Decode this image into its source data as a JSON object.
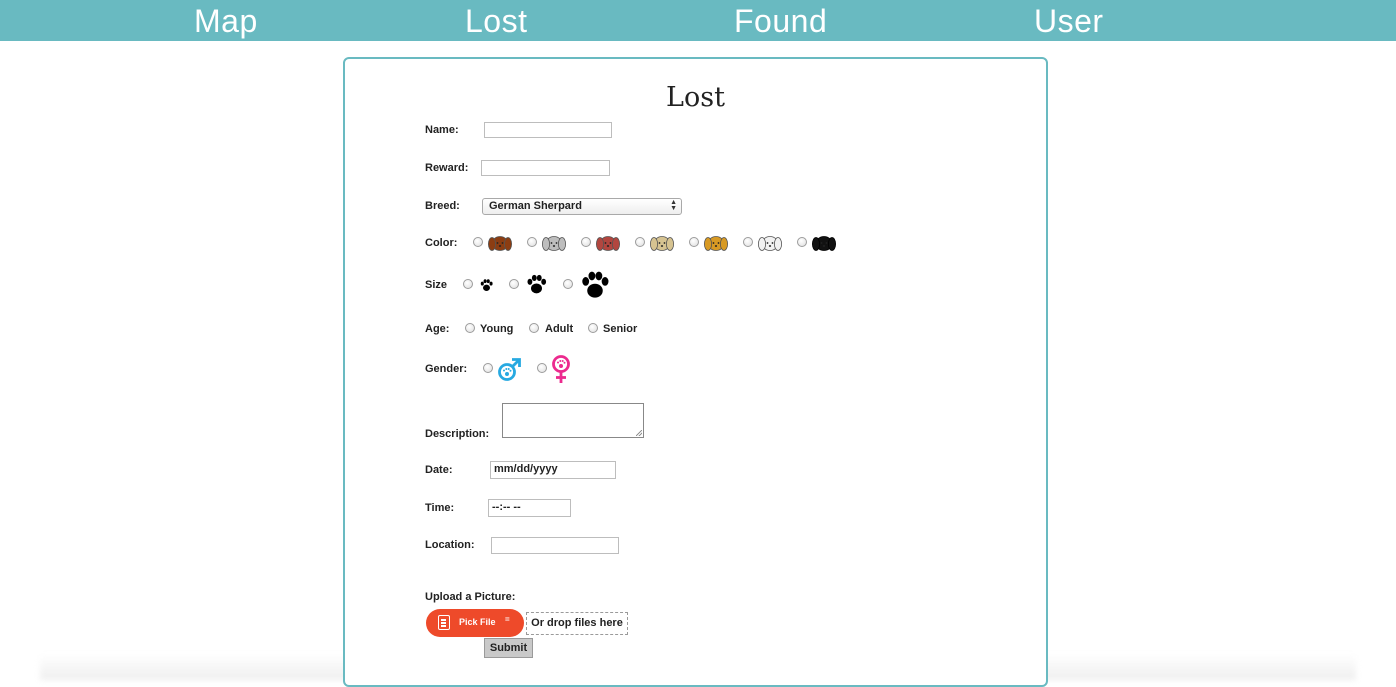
{
  "nav": {
    "items": [
      "Map",
      "Lost",
      "Found",
      "User"
    ]
  },
  "form": {
    "title": "Lost",
    "name_label": "Name:",
    "name_value": "",
    "reward_label": "Reward:",
    "reward_value": "",
    "breed_label": "Breed:",
    "breed_selected": "German Sherpard",
    "color_label": "Color:",
    "colors": [
      "#8c3d12",
      "#bdbdbd",
      "#b2463f",
      "#d6c391",
      "#d89a24",
      "#f2f2f2",
      "#111111"
    ],
    "size_label": "Size",
    "size_icons": [
      "paw-small-icon",
      "paw-medium-icon",
      "paw-large-icon"
    ],
    "age_label": "Age:",
    "age_options": [
      "Young",
      "Adult",
      "Senior"
    ],
    "gender_label": "Gender:",
    "gender_icons": [
      "male-paw-icon",
      "female-paw-icon"
    ],
    "gender_colors": [
      "#27a9e1",
      "#ec2a8e"
    ],
    "description_label": "Description:",
    "date_label": "Date:",
    "date_value": "mm/dd/yyyy",
    "time_label": "Time:",
    "time_value": "--:-- --",
    "location_label": "Location:",
    "location_value": "",
    "upload_label": "Upload a Picture:",
    "pick_file_label": "Pick File",
    "drop_label": "Or drop files here",
    "submit_label": "Submit",
    "accent_color": "#69bac1",
    "pick_color": "#ee4a2a"
  }
}
